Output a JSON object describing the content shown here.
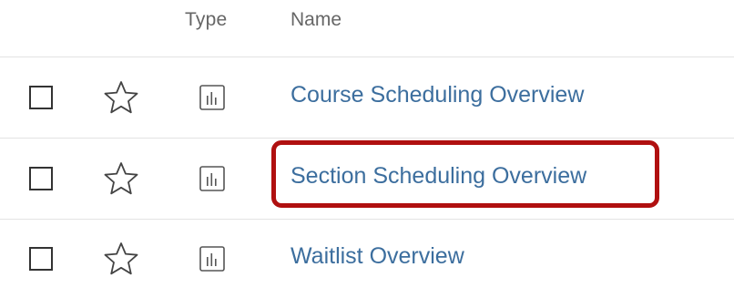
{
  "table": {
    "columns": {
      "type": "Type",
      "name": "Name"
    },
    "rows": [
      {
        "checkbox_checked": false,
        "favorite": false,
        "type_icon": "bar-chart-icon",
        "name": "Course Scheduling Overview"
      },
      {
        "checkbox_checked": false,
        "favorite": false,
        "type_icon": "bar-chart-icon",
        "name": "Section Scheduling Overview",
        "highlighted": true
      },
      {
        "checkbox_checked": false,
        "favorite": false,
        "type_icon": "bar-chart-icon",
        "name": "Waitlist Overview"
      }
    ]
  },
  "icons": {
    "favorite": "star-outline-icon",
    "type": "bar-chart-icon"
  },
  "colors": {
    "link": "#3c6e9e",
    "header_text": "#666666",
    "highlight": "#b01010",
    "divider": "#e3e3e3"
  }
}
